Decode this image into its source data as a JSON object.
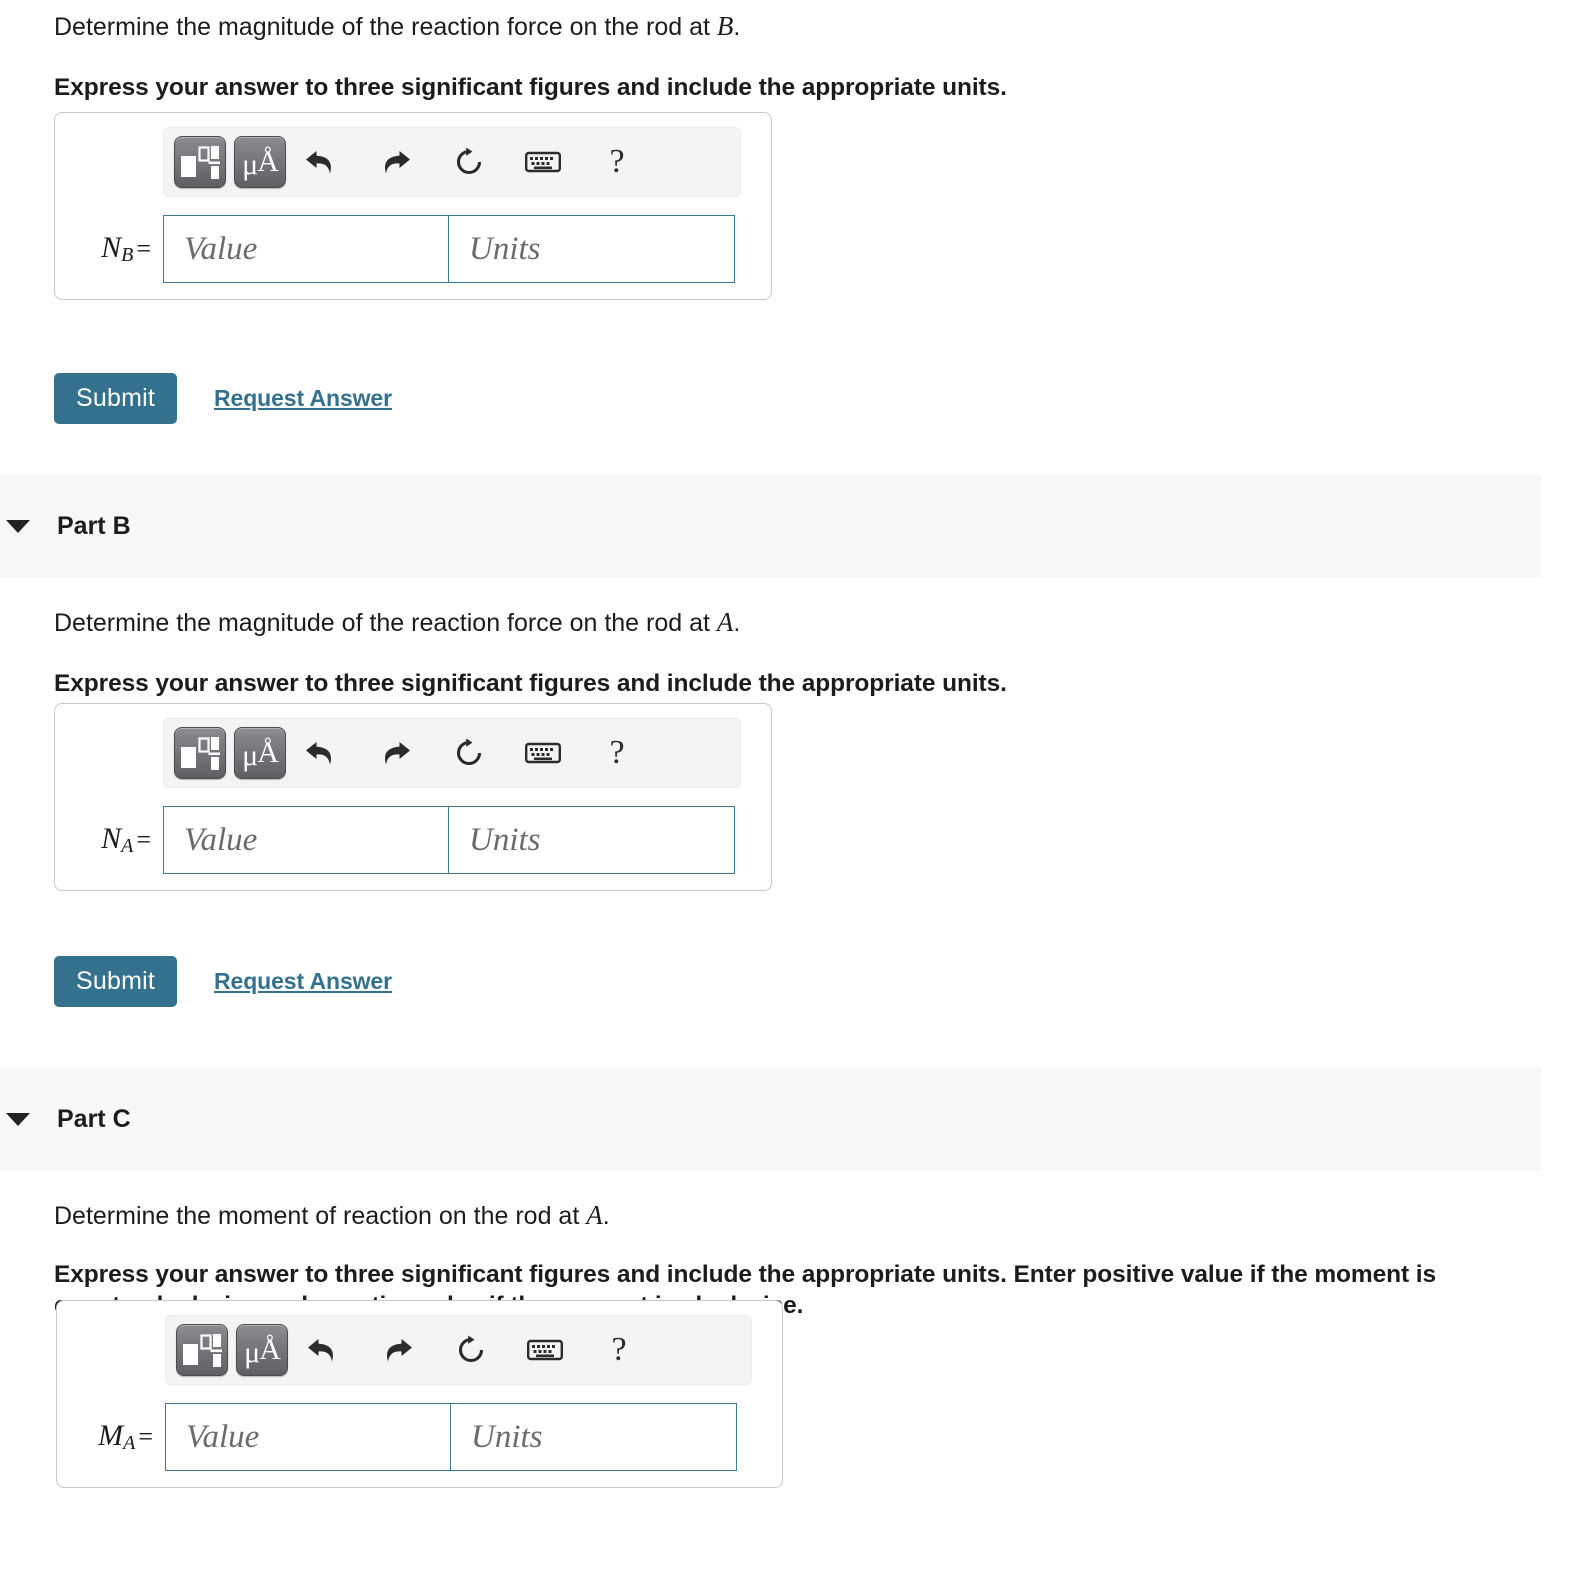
{
  "parts": [
    {
      "id": "part-a-continued",
      "header": null,
      "prompt_pre": "Determine the magnitude of the reaction force on the rod at ",
      "prompt_var": "B",
      "prompt_post": ".",
      "instruction": "Express your answer to three significant figures and include the appropriate units.",
      "answer": {
        "var_base": "N",
        "var_sub": "B",
        "equals": "=",
        "value_placeholder": "Value",
        "units_placeholder": "Units"
      },
      "actions": {
        "submit_label": "Submit",
        "request_label": "Request Answer"
      }
    },
    {
      "id": "part-b",
      "header": "Part B",
      "prompt_pre": "Determine the magnitude of the reaction force on the rod at ",
      "prompt_var": "A",
      "prompt_post": ".",
      "instruction": "Express your answer to three significant figures and include the appropriate units.",
      "answer": {
        "var_base": "N",
        "var_sub": "A",
        "equals": "=",
        "value_placeholder": "Value",
        "units_placeholder": "Units"
      },
      "actions": {
        "submit_label": "Submit",
        "request_label": "Request Answer"
      }
    },
    {
      "id": "part-c",
      "header": "Part C",
      "prompt_pre": "Determine the moment of reaction on the rod at ",
      "prompt_var": "A",
      "prompt_post": ".",
      "instruction": "Express your answer to three significant figures and include the appropriate units. Enter positive value if the moment is counterclockwise and negative value if the moment is clockwise.",
      "answer": {
        "var_base": "M",
        "var_sub": "A",
        "equals": "=",
        "value_placeholder": "Value",
        "units_placeholder": "Units"
      },
      "actions": null
    }
  ],
  "toolbar": {
    "buttons": [
      {
        "name": "math-templates-button",
        "label": ""
      },
      {
        "name": "units-micro-angstrom-button",
        "mu": "μ",
        "angstrom": "Å"
      }
    ],
    "icons": [
      {
        "name": "undo-icon",
        "title": "undo"
      },
      {
        "name": "redo-icon",
        "title": "redo"
      },
      {
        "name": "reset-icon",
        "title": "reset"
      },
      {
        "name": "keyboard-icon",
        "title": "keyboard"
      },
      {
        "name": "help-icon",
        "title": "help",
        "glyph": "?"
      }
    ]
  },
  "colors": {
    "accent": "#34718f",
    "field_border": "#3b7893",
    "band_bg": "#f8f8f8",
    "toolbar_bg": "#f4f4f4",
    "box_border": "#c9c9c9",
    "text": "#1c1c1c"
  }
}
